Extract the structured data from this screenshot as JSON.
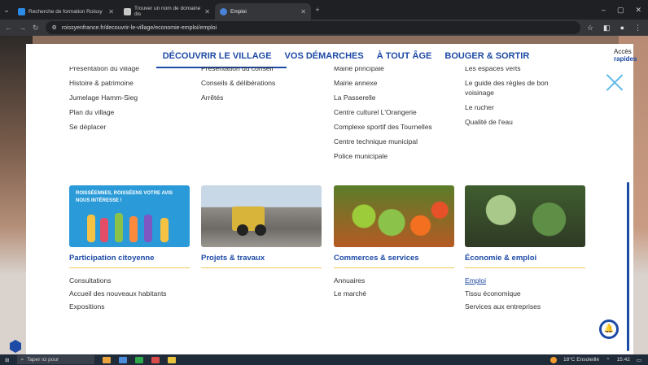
{
  "browser": {
    "tabs": [
      {
        "title": "Recherche de formation Roissy",
        "fav": "#2b8be6"
      },
      {
        "title": "Trouver un nom de domaine dis",
        "fav": "#c7c7c7"
      },
      {
        "title": "Emploi",
        "fav": "#4a82d9"
      }
    ],
    "url": "roissyenfrance.fr/decouvrir-le-village/economie-emploi/emploi",
    "window_controls": [
      "–",
      "▢",
      "✕"
    ]
  },
  "nav": {
    "items": [
      "DÉCOUVRIR LE VILLAGE",
      "VOS DÉMARCHES",
      "À TOUT ÂGE",
      "BOUGER & SORTIR"
    ],
    "acces_line1": "Accès",
    "acces_line2": "rapides"
  },
  "columns": [
    {
      "items": [
        "Présentation du village",
        "Histoire & patrimoine",
        "Jumelage Hamm-Sieg",
        "Plan du village",
        "Se déplacer"
      ]
    },
    {
      "items": [
        "Présentation du conseil",
        "Conseils & délibérations",
        "Arrêtés"
      ]
    },
    {
      "items": [
        "Mairie principale",
        "Mairie annexe",
        "La Passerelle",
        "Centre culturel L'Orangerie",
        "Complexe sportif des Tournelles",
        "Centre technique municipal",
        "Police municipale"
      ]
    },
    {
      "items": [
        "Les espaces verts",
        "Le guide des règles de bon voisinage",
        "Le rucher",
        "Qualité de l'eau"
      ]
    }
  ],
  "cards": [
    {
      "title": "Participation citoyenne",
      "image_text": "ROISSÉENNES, ROISSÉENS VOTRE AVIS NOUS INTÉRESSE !",
      "links": [
        "Consultations",
        "Accueil des nouveaux habitants",
        "Expositions"
      ]
    },
    {
      "title": "Projets & travaux",
      "links": []
    },
    {
      "title": "Commerces & services",
      "links": [
        "Annuaires",
        "Le marché"
      ]
    },
    {
      "title": "Économie & emploi",
      "links": [
        "Emploi",
        "Tissu économique",
        "Services aux entreprises"
      ]
    }
  ],
  "taskbar": {
    "search_placeholder": "Taper ici pour",
    "weather": "18°C Ensoleillé",
    "time": "15:42"
  },
  "colors": {
    "brand": "#1d4aa5",
    "accent": "#f0c75a",
    "close": "#5db9e8"
  }
}
